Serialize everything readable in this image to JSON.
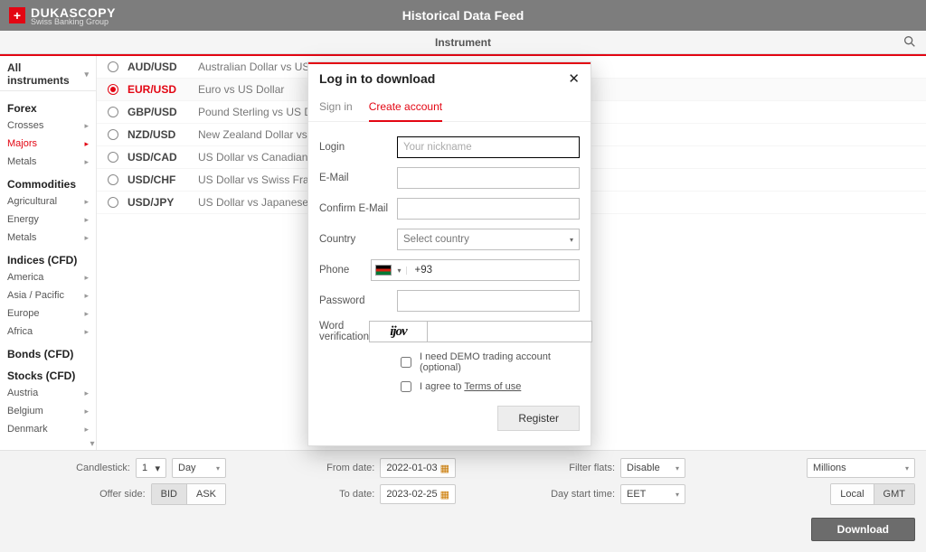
{
  "header": {
    "brand": "DUKASCOPY",
    "brand_sub": "Swiss Banking Group",
    "title": "Historical Data Feed"
  },
  "subheader": {
    "label": "Instrument",
    "search_icon": "search"
  },
  "sidebar": {
    "all_label": "All instruments",
    "groups": [
      {
        "title": "Forex",
        "items": [
          {
            "label": "Crosses",
            "active": false
          },
          {
            "label": "Majors",
            "active": true
          },
          {
            "label": "Metals",
            "active": false
          }
        ]
      },
      {
        "title": "Commodities",
        "items": [
          {
            "label": "Agricultural",
            "active": false
          },
          {
            "label": "Energy",
            "active": false
          },
          {
            "label": "Metals",
            "active": false
          }
        ]
      },
      {
        "title": "Indices (CFD)",
        "items": [
          {
            "label": "America",
            "active": false
          },
          {
            "label": "Asia / Pacific",
            "active": false
          },
          {
            "label": "Europe",
            "active": false
          },
          {
            "label": "Africa",
            "active": false
          }
        ]
      },
      {
        "title": "Bonds (CFD)",
        "items": []
      },
      {
        "title": "Stocks (CFD)",
        "items": [
          {
            "label": "Austria",
            "active": false
          },
          {
            "label": "Belgium",
            "active": false
          },
          {
            "label": "Denmark",
            "active": false
          }
        ]
      }
    ]
  },
  "instruments": [
    {
      "symbol": "AUD/USD",
      "desc": "Australian Dollar vs US Dollar",
      "selected": false
    },
    {
      "symbol": "EUR/USD",
      "desc": "Euro vs US Dollar",
      "selected": true
    },
    {
      "symbol": "GBP/USD",
      "desc": "Pound Sterling vs US Dollar",
      "selected": false
    },
    {
      "symbol": "NZD/USD",
      "desc": "New Zealand Dollar vs US Dollar",
      "selected": false
    },
    {
      "symbol": "USD/CAD",
      "desc": "US Dollar vs Canadian Dollar",
      "selected": false
    },
    {
      "symbol": "USD/CHF",
      "desc": "US Dollar vs Swiss Franc",
      "selected": false
    },
    {
      "symbol": "USD/JPY",
      "desc": "US Dollar vs Japanese Yen",
      "selected": false
    }
  ],
  "toolbar": {
    "candlestick_label": "Candlestick:",
    "candlestick_num": "1",
    "candlestick_unit": "Day",
    "offer_label": "Offer side:",
    "offer_bid": "BID",
    "offer_ask": "ASK",
    "from_label": "From date:",
    "from_value": "2022-01-03",
    "to_label": "To date:",
    "to_value": "2023-02-25",
    "filter_label": "Filter flats:",
    "filter_value": "Disable",
    "daystart_label": "Day start time:",
    "daystart_value": "EET",
    "volume_unit": "Millions",
    "tz_local": "Local",
    "tz_gmt": "GMT",
    "download": "Download"
  },
  "modal": {
    "title": "Log in to download",
    "tab_signin": "Sign in",
    "tab_create": "Create account",
    "login_label": "Login",
    "login_placeholder": "Your nickname",
    "email_label": "E-Mail",
    "confirm_email_label": "Confirm E-Mail",
    "country_label": "Country",
    "country_placeholder": "Select country",
    "phone_label": "Phone",
    "phone_prefix": "+93",
    "password_label": "Password",
    "captcha_label": "Word verification",
    "captcha_text": "ijov",
    "demo_label": "I need DEMO trading account (optional)",
    "agree_prefix": "I agree to ",
    "agree_link": "Terms of use",
    "register": "Register"
  }
}
